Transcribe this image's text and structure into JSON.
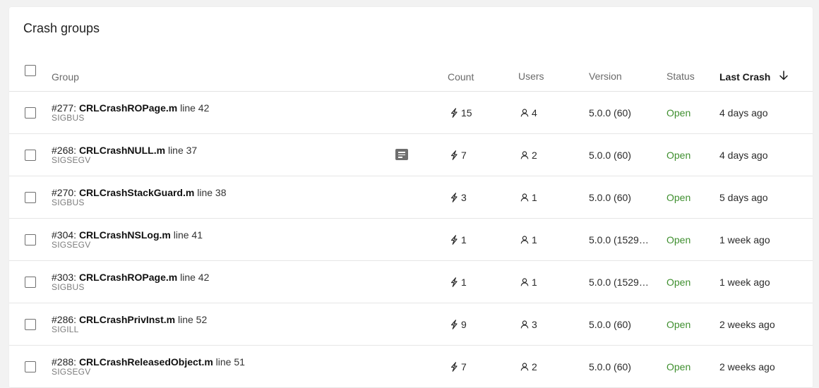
{
  "panel": {
    "title": "Crash groups"
  },
  "table": {
    "headers": {
      "group": "Group",
      "count": "Count",
      "users": "Users",
      "version": "Version",
      "status": "Status",
      "last_crash": "Last Crash"
    },
    "sort": {
      "column": "last_crash",
      "direction": "descending",
      "icon": "arrow-down-icon"
    },
    "rows": [
      {
        "id": "#277:",
        "file": "CRLCrashROPage.m",
        "line": "line 42",
        "signal": "SIGBUS",
        "count": "15",
        "users": "4",
        "version": "5.0.0 (60)",
        "status": "Open",
        "last_crash": "4 days ago",
        "has_note": false
      },
      {
        "id": "#268:",
        "file": "CRLCrashNULL.m",
        "line": "line 37",
        "signal": "SIGSEGV",
        "count": "7",
        "users": "2",
        "version": "5.0.0 (60)",
        "status": "Open",
        "last_crash": "4 days ago",
        "has_note": true
      },
      {
        "id": "#270:",
        "file": "CRLCrashStackGuard.m",
        "line": "line 38",
        "signal": "SIGBUS",
        "count": "3",
        "users": "1",
        "version": "5.0.0 (60)",
        "status": "Open",
        "last_crash": "5 days ago",
        "has_note": false
      },
      {
        "id": "#304:",
        "file": "CRLCrashNSLog.m",
        "line": "line 41",
        "signal": "SIGSEGV",
        "count": "1",
        "users": "1",
        "version": "5.0.0 (1529…",
        "status": "Open",
        "last_crash": "1 week ago",
        "has_note": false
      },
      {
        "id": "#303:",
        "file": "CRLCrashROPage.m",
        "line": "line 42",
        "signal": "SIGBUS",
        "count": "1",
        "users": "1",
        "version": "5.0.0 (1529…",
        "status": "Open",
        "last_crash": "1 week ago",
        "has_note": false
      },
      {
        "id": "#286:",
        "file": "CRLCrashPrivInst.m",
        "line": "line 52",
        "signal": "SIGILL",
        "count": "9",
        "users": "3",
        "version": "5.0.0 (60)",
        "status": "Open",
        "last_crash": "2 weeks ago",
        "has_note": false
      },
      {
        "id": "#288:",
        "file": "CRLCrashReleasedObject.m",
        "line": "line 51",
        "signal": "SIGSEGV",
        "count": "7",
        "users": "2",
        "version": "5.0.0 (60)",
        "status": "Open",
        "last_crash": "2 weeks ago",
        "has_note": false
      }
    ]
  },
  "colors": {
    "status_open": "#3f8f2f",
    "note_icon": "#6e6e6e"
  },
  "icons": {
    "count": "bolt-icon",
    "users": "person-icon",
    "note": "note-icon"
  }
}
